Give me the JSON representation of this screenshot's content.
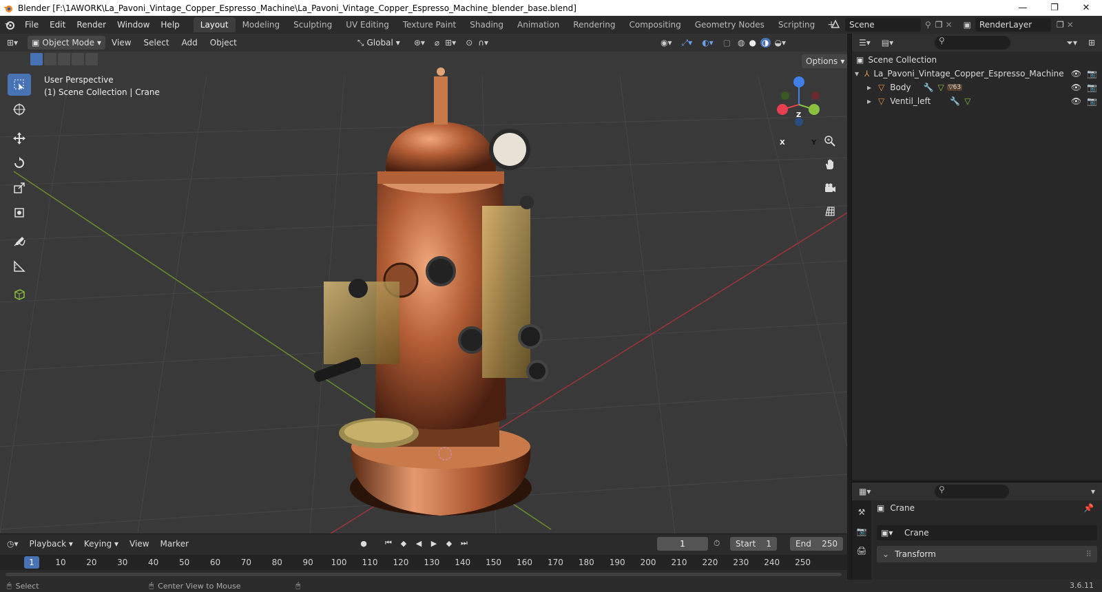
{
  "window": {
    "title": "Blender [F:\\1AWORK\\La_Pavoni_Vintage_Copper_Espresso_Machine\\La_Pavoni_Vintage_Copper_Espresso_Machine_blender_base.blend]",
    "minimize": "—",
    "maximize": "❐",
    "close": "✕"
  },
  "menus": [
    "File",
    "Edit",
    "Render",
    "Window",
    "Help"
  ],
  "workspace_tabs": [
    "Layout",
    "Modeling",
    "Sculpting",
    "UV Editing",
    "Texture Paint",
    "Shading",
    "Animation",
    "Rendering",
    "Compositing",
    "Geometry Nodes",
    "Scripting"
  ],
  "active_workspace": "Layout",
  "scene": {
    "name": "Scene",
    "render_layer": "RenderLayer"
  },
  "viewport": {
    "mode": "Object Mode",
    "menus": [
      "View",
      "Select",
      "Add",
      "Object"
    ],
    "orientation": "Global",
    "options_label": "Options",
    "perspective_label": "User Perspective",
    "collection_label": "(1) Scene Collection | Crane",
    "axis_x": "X",
    "axis_y": "Y",
    "axis_z": "Z"
  },
  "timeline": {
    "menus": [
      "Playback",
      "Keying",
      "View",
      "Marker"
    ],
    "current_frame": "1",
    "start_label": "Start",
    "start_value": "1",
    "end_label": "End",
    "end_value": "250",
    "ruler_ticks": [
      "1",
      "10",
      "20",
      "30",
      "40",
      "50",
      "60",
      "70",
      "80",
      "90",
      "100",
      "110",
      "120",
      "130",
      "140",
      "150",
      "160",
      "170",
      "180",
      "190",
      "200",
      "210",
      "220",
      "230",
      "240",
      "250"
    ]
  },
  "status": {
    "select": "Select",
    "center_view": "Center View to Mouse",
    "version": "3.6.11"
  },
  "outliner": {
    "root": "Scene Collection",
    "collection": "La_Pavoni_Vintage_Copper_Espresso_Machine",
    "items": [
      {
        "name": "Body",
        "badge": "63"
      },
      {
        "name": "Ventil_left",
        "badge": ""
      }
    ]
  },
  "properties": {
    "object_name": "Crane",
    "data_name": "Crane",
    "panel": "Transform"
  },
  "colors": {
    "accent": "#4772b3",
    "copper": "#b8643a",
    "x_axis": "#e6404f",
    "y_axis": "#8ac13f",
    "z_axis": "#3f7fe6"
  }
}
